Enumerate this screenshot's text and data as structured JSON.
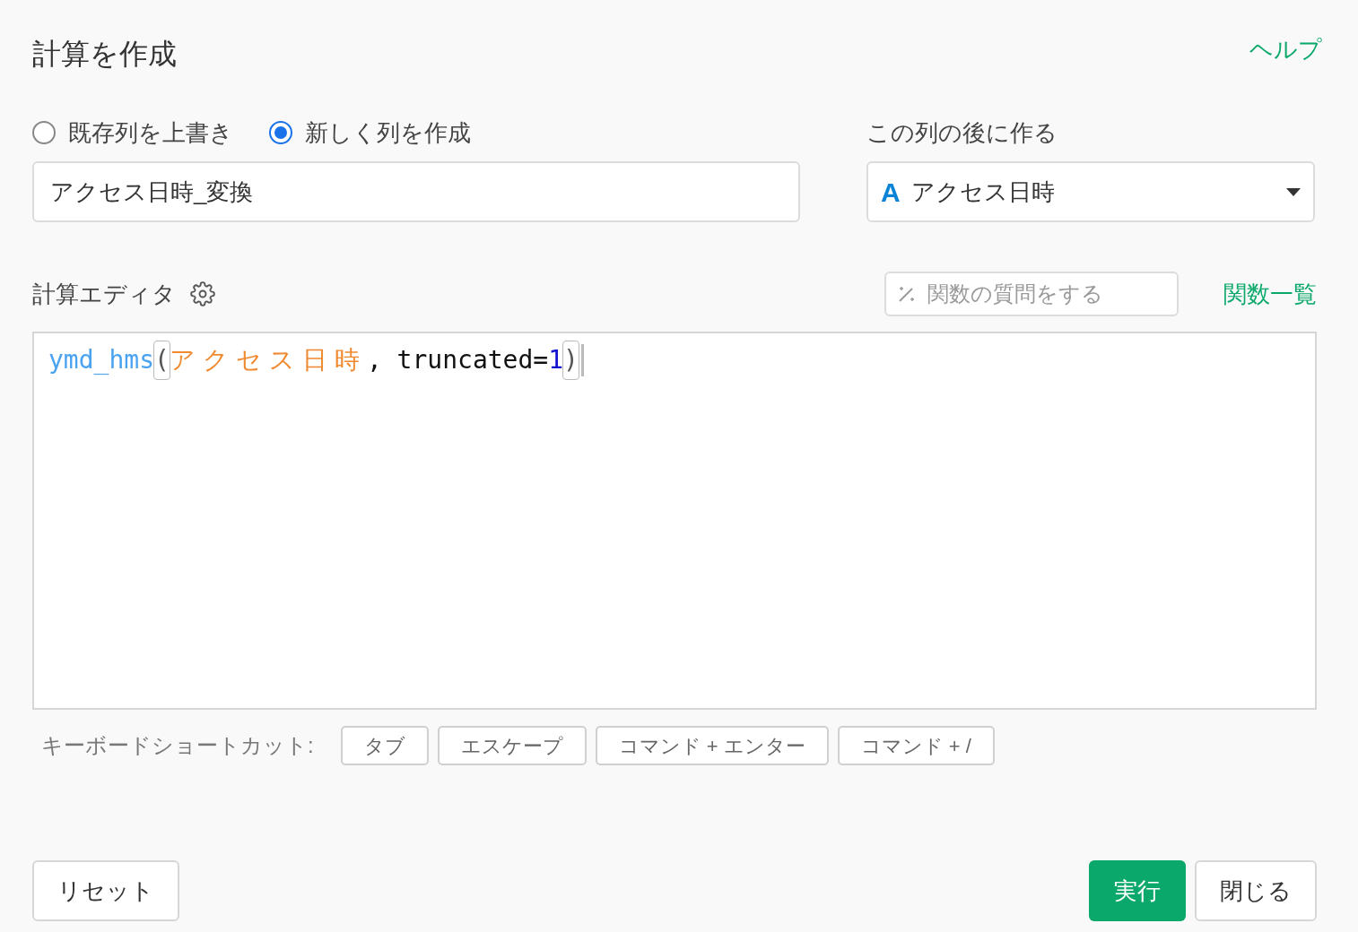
{
  "dialog": {
    "title": "計算を作成",
    "help_link": "ヘルプ"
  },
  "mode_options": [
    {
      "label": "既存列を上書き",
      "selected": false
    },
    {
      "label": "新しく列を作成",
      "selected": true
    }
  ],
  "column_name_field": {
    "value": "アクセス日時_変換"
  },
  "insert_after": {
    "label": "この列の後に作る",
    "type_letter": "A",
    "value": "アクセス日時"
  },
  "editor": {
    "label": "計算エディタ",
    "ask_field": {
      "placeholder": "関数の質問をする"
    },
    "function_list_link": "関数一覧",
    "tokens": [
      {
        "kind": "function",
        "text": "ymd_hms",
        "matched": false
      },
      {
        "kind": "bracket",
        "text": "(",
        "matched": true
      },
      {
        "kind": "column",
        "text": "アクセス日時",
        "matched": false
      },
      {
        "kind": "plain",
        "text": ", truncated=",
        "matched": false
      },
      {
        "kind": "number",
        "text": "1",
        "matched": false
      },
      {
        "kind": "bracket",
        "text": ")",
        "matched": true
      }
    ]
  },
  "shortcuts": {
    "label": "キーボードショートカット:",
    "keys": [
      "タブ",
      "エスケープ",
      "コマンド + エンター",
      "コマンド + /"
    ]
  },
  "buttons": {
    "reset": "リセット",
    "run": "実行",
    "close": "閉じる"
  }
}
